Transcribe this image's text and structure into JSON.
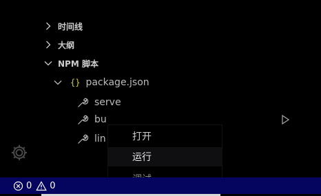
{
  "explorer": {
    "sections": [
      {
        "label": "时间线",
        "expanded": false
      },
      {
        "label": "大纲",
        "expanded": false
      },
      {
        "label": "NPM 脚本",
        "expanded": true
      }
    ],
    "package": {
      "icon": "{}",
      "label": "package.json"
    },
    "scripts": [
      {
        "label": "serve"
      },
      {
        "label": "bu"
      },
      {
        "label": "lin"
      }
    ]
  },
  "context_menu": {
    "items": [
      {
        "label": "打开"
      },
      {
        "label": "运行"
      },
      {
        "label": "调试"
      }
    ]
  },
  "status_bar": {
    "errors": "0",
    "warnings": "0"
  },
  "colors": {
    "status_bar_bg": "#050560",
    "json_icon": "#cbcb41"
  }
}
